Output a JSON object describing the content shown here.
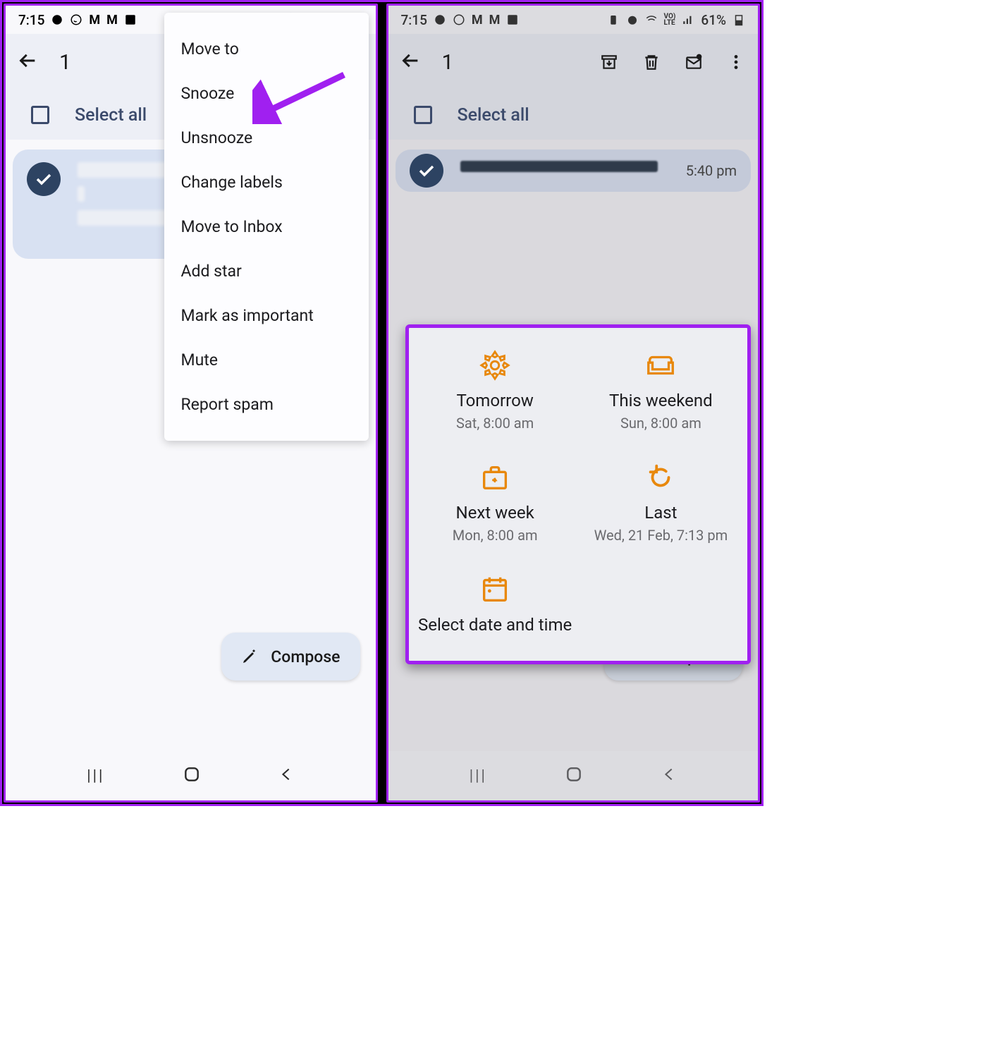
{
  "status": {
    "time": "7:15",
    "battery": "61%"
  },
  "header": {
    "count": "1"
  },
  "select_all": "Select all",
  "fab": {
    "label": "Compose"
  },
  "menu": {
    "items": [
      "Move to",
      "Snooze",
      "Unsnooze",
      "Change labels",
      "Move to Inbox",
      "Add star",
      "Mark as important",
      "Mute",
      "Report spam"
    ]
  },
  "mail": {
    "time": "5:40 pm"
  },
  "snooze": {
    "opts": [
      {
        "title": "Tomorrow",
        "sub": "Sat, 8:00 am"
      },
      {
        "title": "This weekend",
        "sub": "Sun, 8:00 am"
      },
      {
        "title": "Next week",
        "sub": "Mon, 8:00 am"
      },
      {
        "title": "Last",
        "sub": "Wed, 21 Feb, 7:13 pm"
      },
      {
        "title": "Select date and time",
        "sub": ""
      }
    ]
  }
}
